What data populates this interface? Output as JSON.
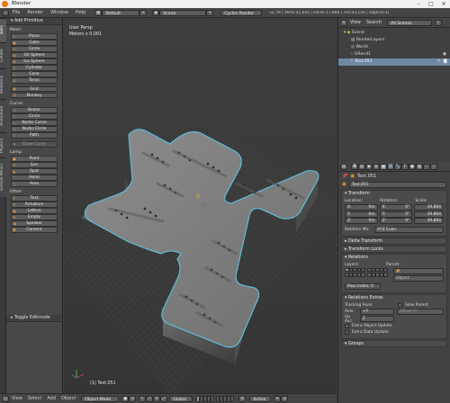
{
  "window": {
    "title": "Blender"
  },
  "info_header": {
    "menus": [
      "File",
      "Render",
      "Window",
      "Help"
    ],
    "layout": "Default",
    "scene": "Scene",
    "engine": "Cycles Render",
    "stats": "v2.79 | Verts:21,655 | Faces:17,660 | Tris:43,156 | Objects:1/2"
  },
  "tabs": [
    "Tools",
    "Create",
    "Relations",
    "Animation",
    "Physics",
    "Grease Pencil"
  ],
  "toolshelf": {
    "panel_title": "Add Primitive",
    "groups": [
      {
        "label": "Mesh:",
        "items": [
          "Plane",
          "Cube",
          "Circle",
          "UV Sphere",
          "Ico Sphere",
          "Cylinder",
          "Cone",
          "Torus",
          "Grid",
          "Monkey"
        ]
      },
      {
        "label": "Curve:",
        "items": [
          "Bezier",
          "Circle",
          "Nurbs Curve",
          "Nurbs Circle",
          "Path"
        ]
      },
      {
        "label": "",
        "items": [
          "Draw Curve"
        ]
      },
      {
        "label": "Lamp:",
        "items": [
          "Point",
          "Sun",
          "Spot",
          "Hemi",
          "Area"
        ]
      },
      {
        "label": "Other:",
        "items": [
          "Text",
          "Armature",
          "Lattice",
          "Empty",
          "Speaker",
          "Camera"
        ]
      }
    ],
    "toggle_label": "Toggle Editmode"
  },
  "viewport": {
    "view_label": "User Persp",
    "unit_label": "Meters x 0.001",
    "object_label": "(1) Text.051"
  },
  "viewport_header": {
    "menus": [
      "View",
      "Select",
      "Add",
      "Object"
    ],
    "mode": "Object Mode",
    "pivot": "Global",
    "layer": "Active"
  },
  "outliner": {
    "menus": [
      "View",
      "Search"
    ],
    "filter": "All Scenes",
    "items": [
      {
        "label": "Scene"
      },
      {
        "label": "RenderLayers"
      },
      {
        "label": "World"
      },
      {
        "label": "GRend1"
      },
      {
        "label": "Text.051"
      }
    ]
  },
  "properties": {
    "breadcrumb": "Text.051",
    "object_name": "Text.051",
    "transform": {
      "title": "Transform",
      "col_labels": [
        "Location:",
        "Rotation:",
        "Scale:"
      ],
      "rows": [
        [
          "X:",
          "0m",
          "X:",
          "0°",
          "39.884"
        ],
        [
          "Y:",
          "0m",
          "Y:",
          "0°",
          "39.884"
        ],
        [
          "Z:",
          "0m",
          "Z:",
          "0°",
          "39.884"
        ]
      ],
      "rotation_mode_label": "Rotation Mo:",
      "rotation_mode": "XYZ Euler"
    },
    "delta_title": "Delta Transform",
    "locks_title": "Transform Locks",
    "relations": {
      "title": "Relations",
      "layers_label": "Layers:",
      "parent_label": "Parent:",
      "parent_type": "Object",
      "pass_index": "Pass Index: 0"
    },
    "relations_extras": {
      "title": "Relations Extras",
      "tracking_label": "Tracking Axes:",
      "axis_label": "Axis:",
      "axis_value": "+Y",
      "up_label": "Up Axi:",
      "up_value": "Z",
      "slow_parent": "Slow Parent",
      "offset_label": "Offset: 0",
      "extra_obj": "Extra Object Update",
      "extra_data": "Extra Data Update"
    },
    "groups_title": "Groups"
  },
  "colors": {
    "accent": "#e87d0d",
    "selection": "#6e88a4",
    "outline": "#5fbcd8",
    "object": "#7d7d7d"
  }
}
